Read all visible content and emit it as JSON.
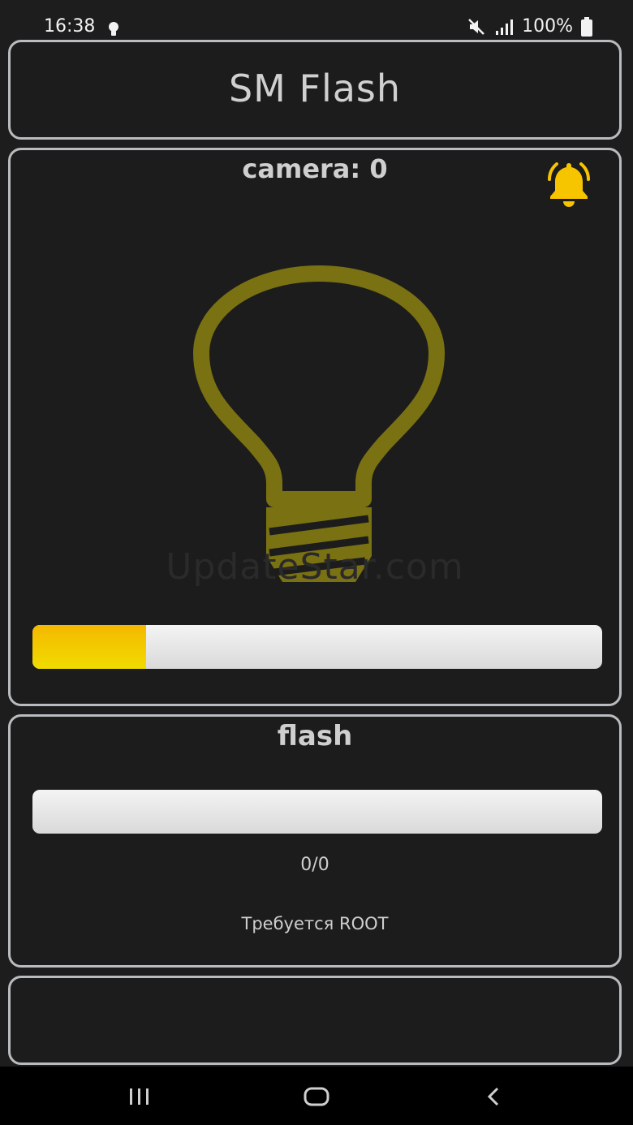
{
  "status_bar": {
    "time": "16:38",
    "battery": "100%",
    "icons": [
      "bulb-icon",
      "mute-icon",
      "signal-icon",
      "battery-icon"
    ]
  },
  "app": {
    "title": "SM Flash",
    "watermark": "UpdateStar.com"
  },
  "camera_panel": {
    "label": "camera: 0",
    "alarm_icon": "alarm-bell-icon",
    "bulb_icon": "light-bulb-icon",
    "progress": 0.2
  },
  "flash_panel": {
    "label": "flash",
    "progress": 0,
    "counter": "0/0",
    "note": "Требуется ROOT"
  },
  "colors": {
    "accent": "#f0c800",
    "bulb": "#7a7112",
    "border": "#b9bcbf",
    "background": "#1c1c1c"
  },
  "nav_bar": {
    "buttons": [
      "recents-icon",
      "home-icon",
      "back-icon"
    ]
  }
}
